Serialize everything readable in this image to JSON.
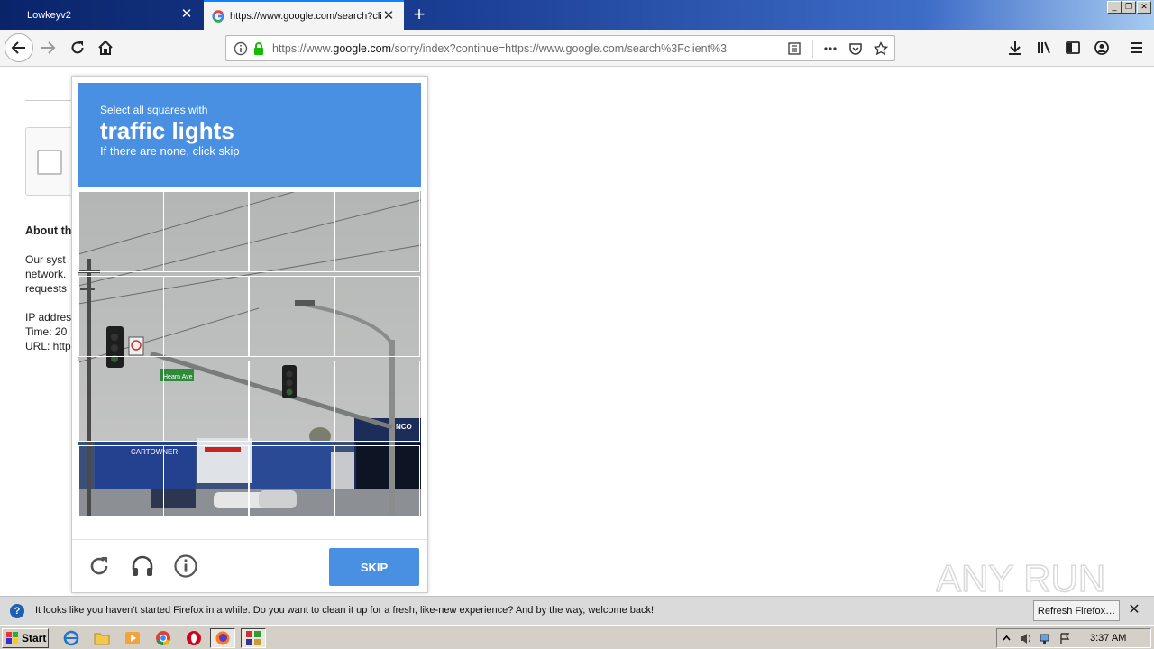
{
  "tabs": [
    {
      "title": "Lowkeyv2",
      "active": false
    },
    {
      "title": "https://www.google.com/search?client=firefox-b-d&q=",
      "active": true
    }
  ],
  "window_buttons": [
    "minimize",
    "restore",
    "close"
  ],
  "toolbar": {
    "url_prefix": "https://www.",
    "url_domain": "google.com",
    "url_rest": "/sorry/index?continue=https://www.google.com/search%3Fclient%3"
  },
  "page": {
    "about_heading": "About th",
    "lines": [
      "Our syst",
      "network.",
      "requests",
      "IP addres",
      "Time: 20",
      "URL: http"
    ]
  },
  "challenge": {
    "line1": "Select all squares with",
    "target": "traffic lights",
    "line3": "If there are none, click skip",
    "skip_label": "SKIP",
    "street_sign": "Hearn Ave",
    "store_sign": "CARTOWNER"
  },
  "watermark": {
    "text": "ANY RUN"
  },
  "notification": {
    "text": "It looks like you haven't started Firefox in a while. Do you want to clean it up for a fresh, like-new experience? And by the way, welcome back!",
    "refresh_label": "Refresh Firefox…"
  },
  "taskbar": {
    "start_label": "Start",
    "clock": "3:37 AM"
  },
  "colors": {
    "challenge_blue": "#4a90e2",
    "tabbar_dark": "#0a246a",
    "taskbar": "#d4d0c8"
  }
}
